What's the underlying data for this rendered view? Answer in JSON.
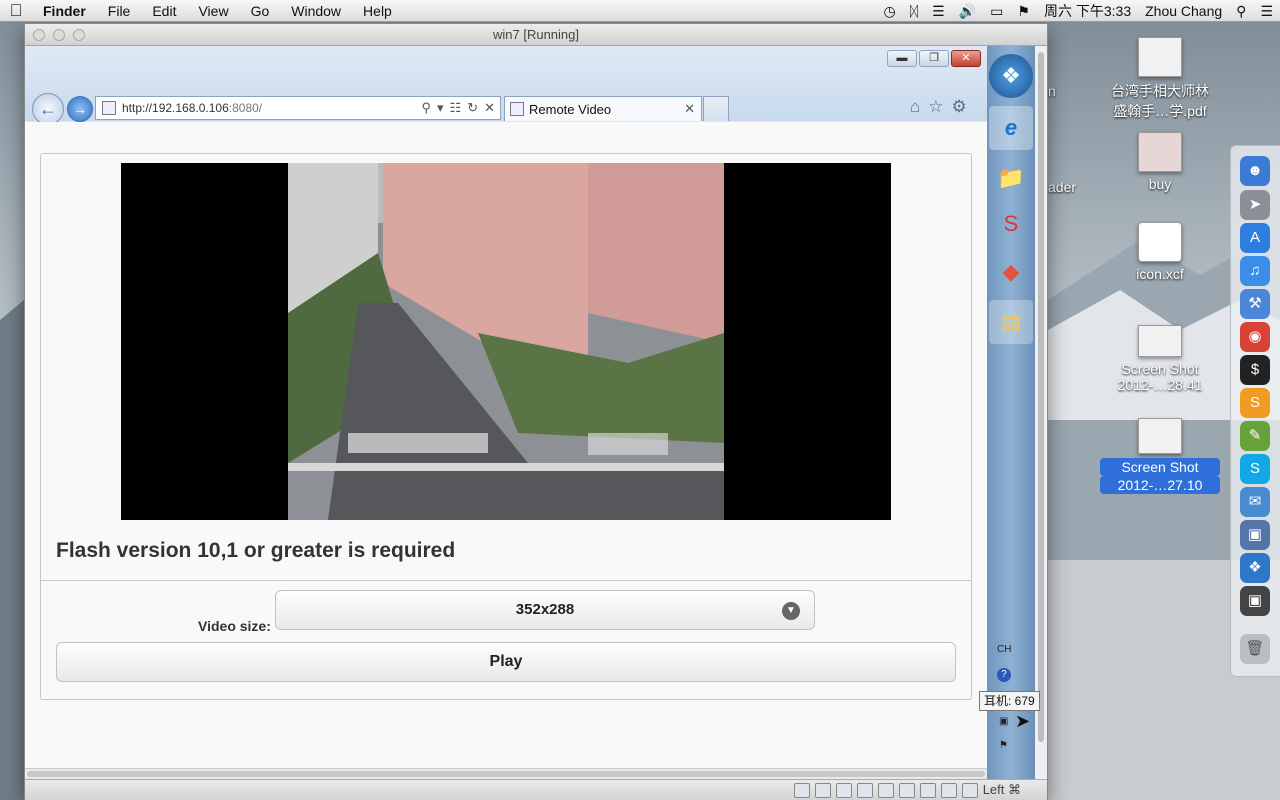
{
  "menubar": {
    "apple": "",
    "app": "Finder",
    "items": [
      "File",
      "Edit",
      "View",
      "Go",
      "Window",
      "Help"
    ],
    "clock": "周六 下午3:33",
    "user": "Zhou Chang"
  },
  "vbox": {
    "title": "win7 [Running]",
    "status_host_key": "Left ⌘"
  },
  "browser": {
    "url_host": "http://192.168.0.106",
    "url_port": ":8080/",
    "tab_title": "Remote Video"
  },
  "page": {
    "flash_message": "Flash version 10,1 or greater is required",
    "video_size_label": "Video size:",
    "video_size_value": "352x288",
    "play_label": "Play"
  },
  "guest_tray": {
    "lang": "CH",
    "tooltip": "耳机: 679"
  },
  "desktop": {
    "partial_labels": [
      "n",
      "ader"
    ],
    "icons": [
      {
        "label_1": "台湾手相大师林",
        "label_2": "盛翰手…学.pdf"
      },
      {
        "label_1": "buy",
        "label_2": ""
      },
      {
        "label_1": "icon.xcf",
        "label_2": ""
      },
      {
        "label_1": "Screen Shot",
        "label_2": "2012-…28.41"
      },
      {
        "label_1": "Screen Shot",
        "label_2": "2012-…27.10"
      }
    ]
  },
  "colors": {
    "selection": "#2e6fd9",
    "taskbar": "#7fa3c9"
  }
}
